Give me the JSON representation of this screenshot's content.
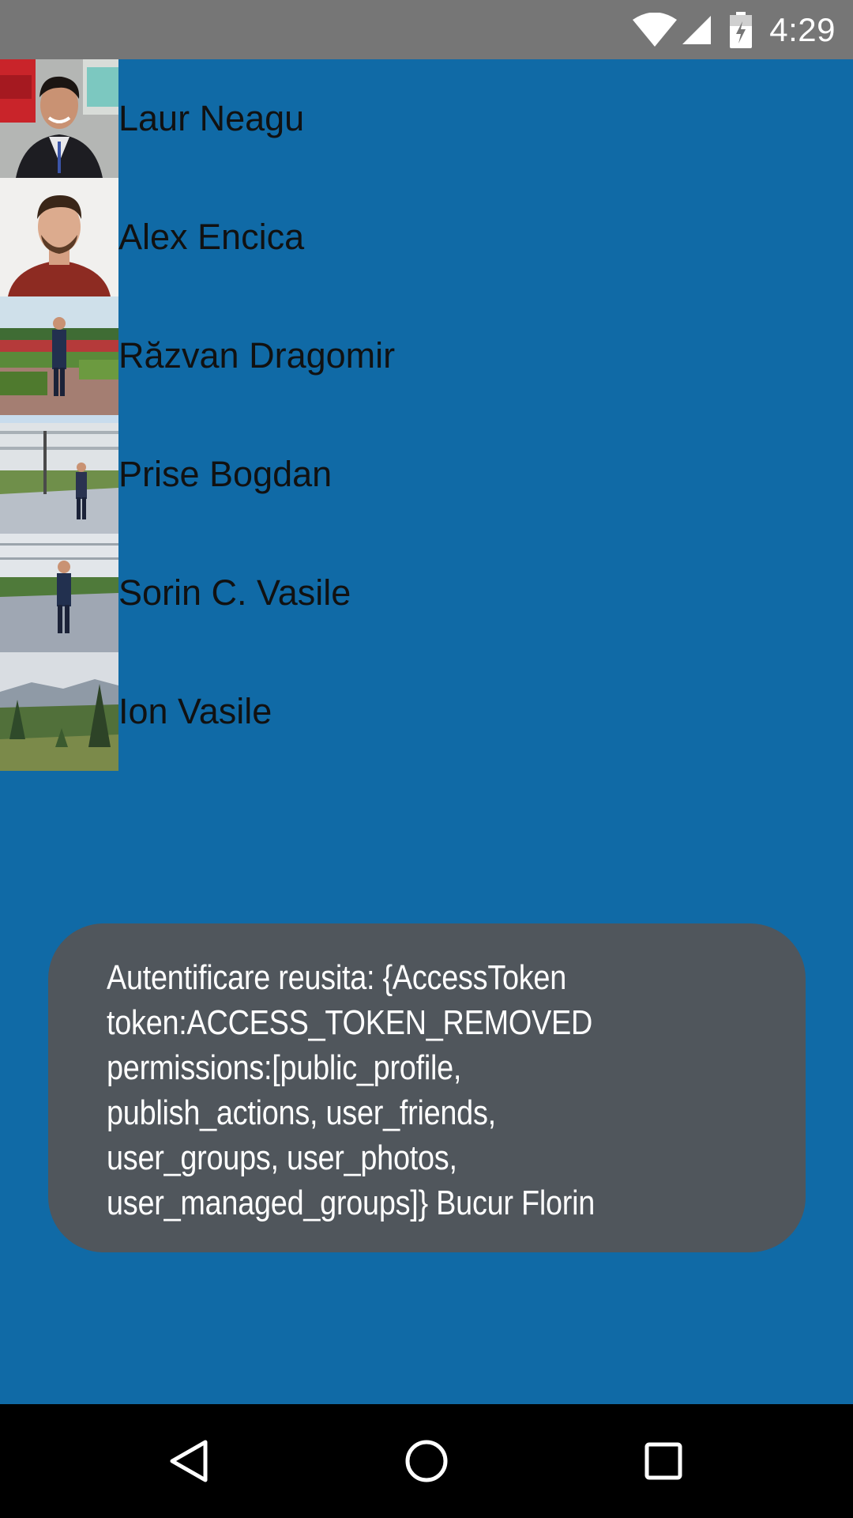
{
  "status_bar": {
    "time": "4:29",
    "icons": [
      "wifi-icon",
      "cell-signal-icon",
      "battery-charging-icon"
    ]
  },
  "friends": [
    {
      "name": "Laur Neagu",
      "avatar": "photo-man-smiling-red-seats"
    },
    {
      "name": "Alex Encica",
      "avatar": "photo-man-red-shirt"
    },
    {
      "name": "Răzvan Dragomir",
      "avatar": "photo-man-suit-garden"
    },
    {
      "name": "Prise Bogdan",
      "avatar": "photo-man-palace"
    },
    {
      "name": "Sorin C. Vasile",
      "avatar": "photo-man-suit-palace"
    },
    {
      "name": "Ion Vasile",
      "avatar": "photo-mountain-landscape"
    }
  ],
  "toast": {
    "message": "Autentificare reusita: {AccessToken\ntoken:ACCESS_TOKEN_REMOVED\npermissions:[public_profile,\npublish_actions, user_friends,\nuser_groups, user_photos,\nuser_managed_groups]} Bucur Florin"
  },
  "nav_bar": {
    "buttons": [
      "back-icon",
      "home-icon",
      "recents-icon"
    ]
  },
  "colors": {
    "background": "#106aa6",
    "status_bar": "#767676",
    "toast": "#50565c",
    "nav_bar": "#000000"
  }
}
